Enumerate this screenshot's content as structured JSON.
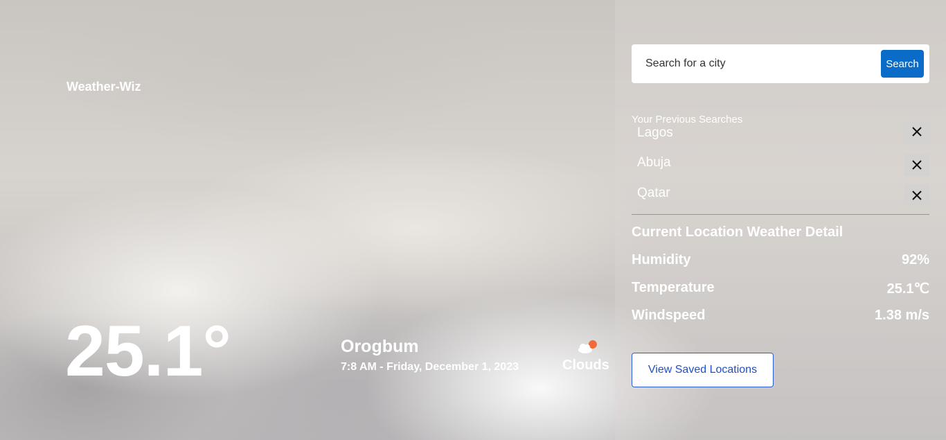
{
  "brand": {
    "name": "Weather-Wiz"
  },
  "current": {
    "temperature": "25.1°",
    "city": "Orogbum",
    "datetime": "7:8 AM - Friday, December 1, 2023",
    "condition": "Clouds",
    "condition_icon": "cloud-sun-icon"
  },
  "search": {
    "placeholder": "Search for a city",
    "value": "",
    "button_label": "Search"
  },
  "previous_searches": {
    "title": "Your Previous Searches",
    "items": [
      {
        "label": "Lagos"
      },
      {
        "label": "Abuja"
      },
      {
        "label": "Qatar"
      }
    ]
  },
  "details": {
    "title": "Current Location Weather Detail",
    "humidity_label": "Humidity",
    "humidity_value": "92%",
    "temperature_label": "Temperature",
    "temperature_value": "25.1℃",
    "windspeed_label": "Windspeed",
    "windspeed_value": "1.38 m/s"
  },
  "saved_button_label": "View Saved Locations",
  "colors": {
    "accent": "#0b6bc8",
    "outline_button": "#2a5bd7",
    "sun": "#f06a3a"
  }
}
